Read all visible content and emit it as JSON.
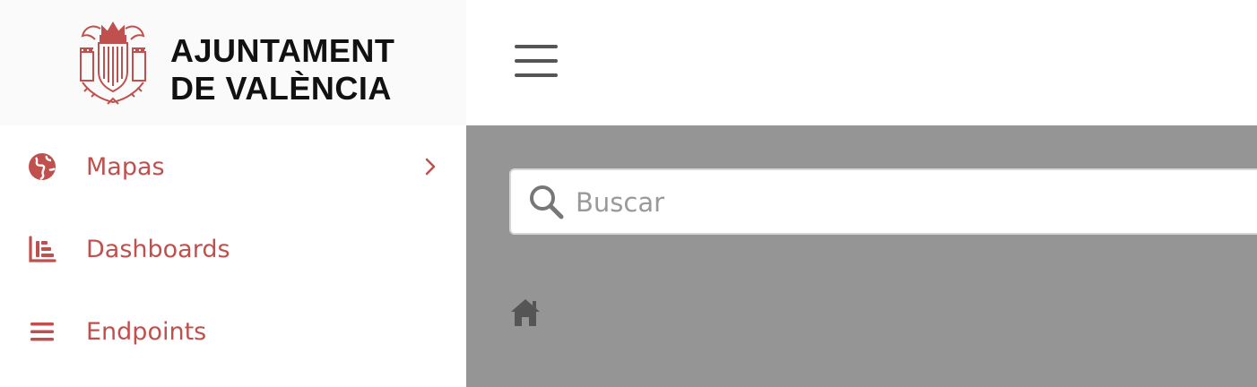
{
  "brand": {
    "line1": "AJUNTAMENT",
    "line2": "DE VALÈNCIA",
    "crest_icon": "valencia-crest-icon",
    "color": "#c0504d"
  },
  "sidebar": {
    "items": [
      {
        "label": "Mapas",
        "icon": "globe-icon",
        "has_submenu": true
      },
      {
        "label": "Dashboards",
        "icon": "chart-bar-icon",
        "has_submenu": false
      },
      {
        "label": "Endpoints",
        "icon": "list-icon",
        "has_submenu": false
      }
    ],
    "accent_color": "#c0504d"
  },
  "header": {
    "menu_icon": "hamburger-menu-icon"
  },
  "search": {
    "placeholder": "Buscar",
    "value": ""
  },
  "breadcrumb": {
    "home_icon": "home-icon"
  },
  "colors": {
    "main_background": "#959595",
    "icon_gray": "#555555"
  }
}
